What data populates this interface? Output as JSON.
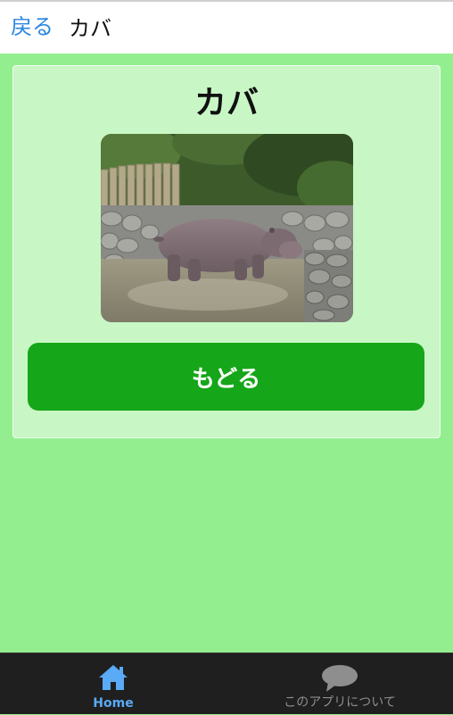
{
  "header": {
    "back_label": "戻る",
    "title": "カバ"
  },
  "card": {
    "title": "カバ",
    "photo_icon": "hippo-photo",
    "back_button_label": "もどる",
    "button_color": "#16a619"
  },
  "tabbar": {
    "tabs": [
      {
        "label": "Home",
        "icon": "home-icon",
        "active": true,
        "color": "#5aaaf5"
      },
      {
        "label": "このアプリについて",
        "icon": "speech-bubble-icon",
        "active": false,
        "color": "#8e8e8e"
      }
    ]
  },
  "colors": {
    "background": "#92ee8f",
    "card": "#c8f7c5",
    "link": "#2a86e0"
  }
}
